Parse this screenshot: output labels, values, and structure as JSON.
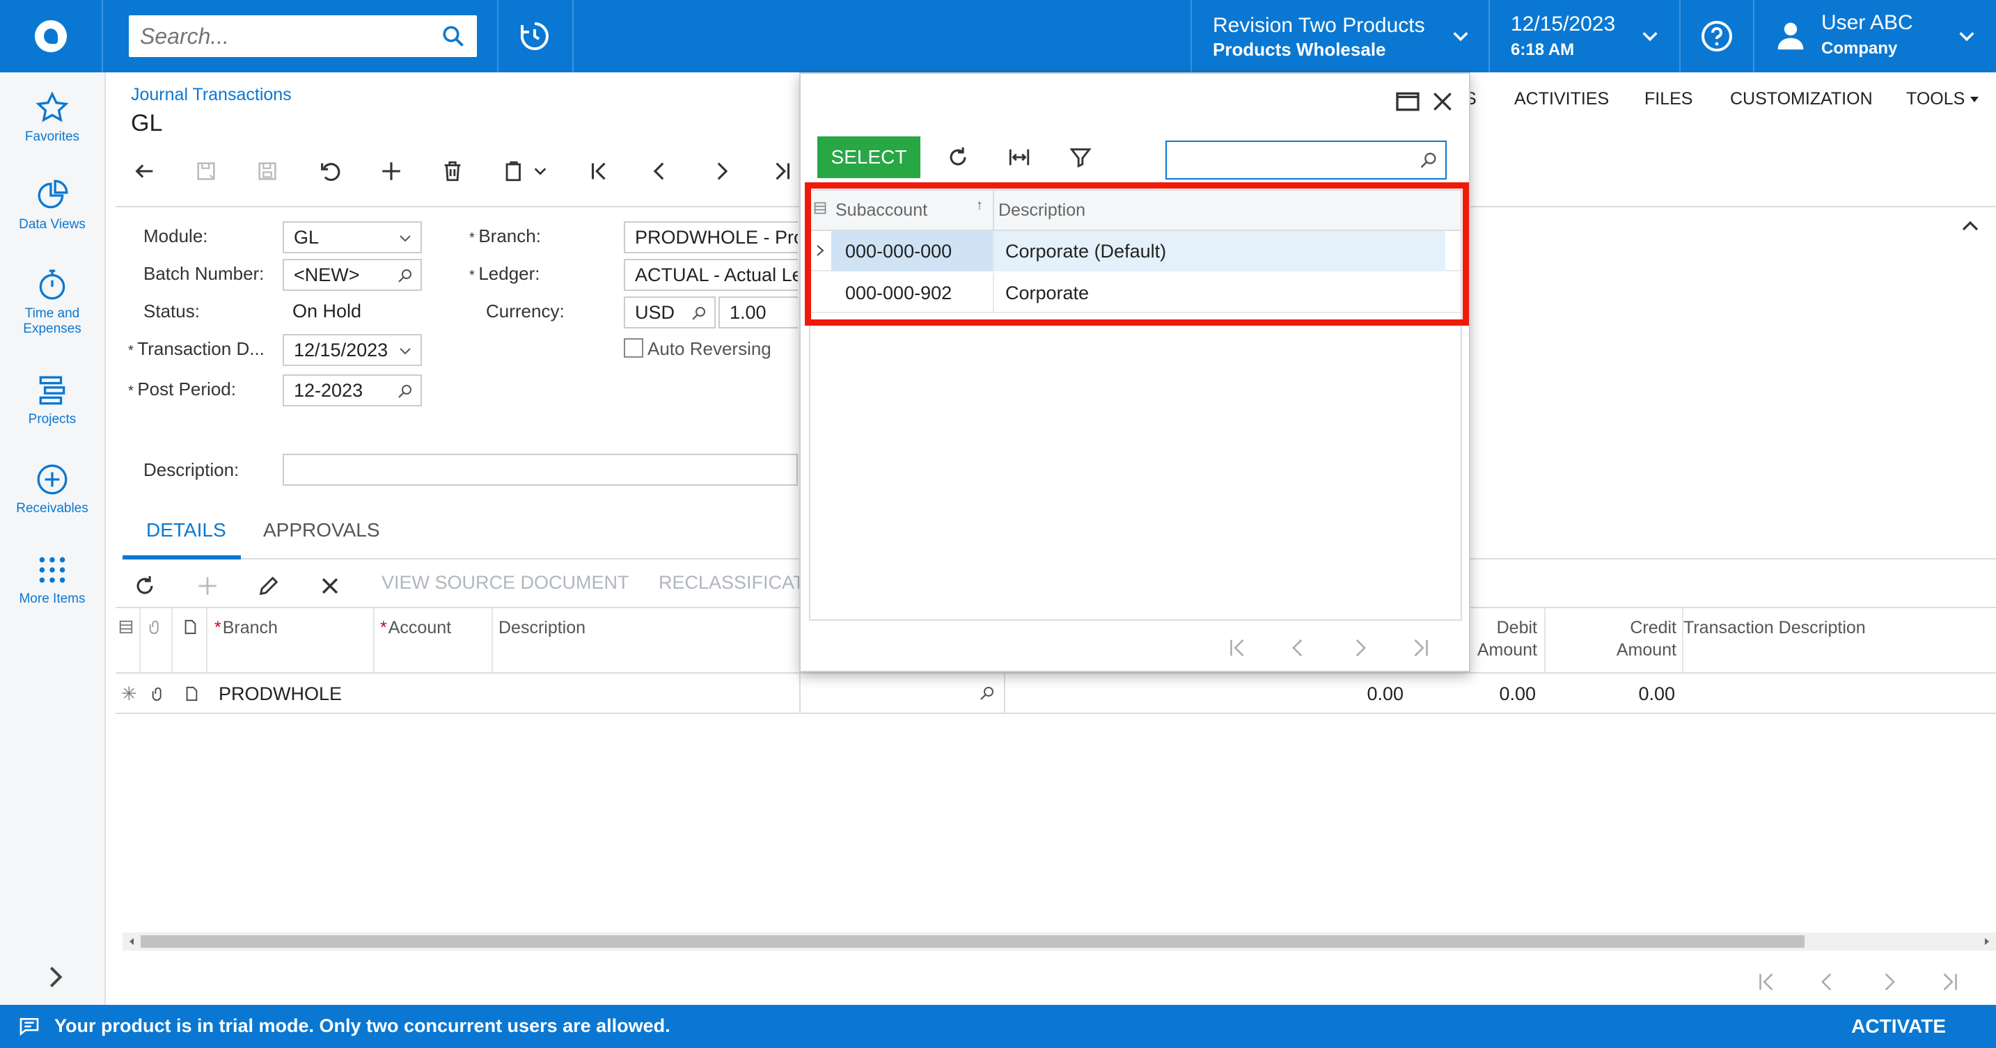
{
  "topbar": {
    "search_placeholder": "Search...",
    "tenant_name": "Revision Two Products",
    "tenant_branch": "Products Wholesale",
    "date": "12/15/2023",
    "time": "6:18 AM",
    "user_name": "User ABC",
    "user_company": "Company"
  },
  "leftnav": {
    "items": [
      {
        "label": "Favorites",
        "icon": "star-icon"
      },
      {
        "label": "Data Views",
        "icon": "pie-chart-icon"
      },
      {
        "label": "Time and Expenses",
        "icon": "stopwatch-icon"
      },
      {
        "label": "Projects",
        "icon": "projects-icon"
      },
      {
        "label": "Receivables",
        "icon": "plus-circle-icon"
      },
      {
        "label": "More Items",
        "icon": "grid-dots-icon"
      }
    ]
  },
  "header": {
    "breadcrumb": "Journal Transactions",
    "title": "GL",
    "right_menu": [
      "ACTIVITIES",
      "FILES",
      "CUSTOMIZATION",
      "TOOLS"
    ],
    "right_menu_partial": "S"
  },
  "form": {
    "module_label": "Module:",
    "module_value": "GL",
    "batch_label": "Batch Number:",
    "batch_value": "<NEW>",
    "status_label": "Status:",
    "status_value": "On Hold",
    "trans_date_label": "Transaction D...",
    "trans_date_value": "12/15/2023",
    "post_period_label": "Post Period:",
    "post_period_value": "12-2023",
    "description_label": "Description:",
    "branch_label": "Branch:",
    "branch_value": "PRODWHOLE - Pro",
    "ledger_label": "Ledger:",
    "ledger_value": "ACTUAL - Actual Le",
    "currency_label": "Currency:",
    "currency_value": "USD",
    "rate_value": "1.00",
    "auto_reversing_label": "Auto Reversing"
  },
  "tabs": {
    "details": "DETAILS",
    "approvals": "APPROVALS"
  },
  "grid_toolbar": {
    "view_source": "VIEW SOURCE DOCUMENT",
    "reclassify": "RECLASSIFICAT"
  },
  "grid": {
    "headers": {
      "branch": "Branch",
      "account": "Account",
      "description": "Description",
      "debit_line1": "Debit",
      "debit_line2": "Amount",
      "credit_line1": "Credit",
      "credit_line2": "Amount",
      "trans_desc": "Transaction Description"
    },
    "row": {
      "branch": "PRODWHOLE",
      "amount_a": "0.00",
      "debit": "0.00",
      "credit": "0.00"
    }
  },
  "lookup": {
    "select_label": "SELECT",
    "search_value": "",
    "col_subaccount": "Subaccount",
    "col_description": "Description",
    "rows": [
      {
        "subaccount": "000-000-000",
        "description": "Corporate (Default)"
      },
      {
        "subaccount": "000-000-902",
        "description": "Corporate"
      }
    ]
  },
  "statusbar": {
    "message": "Your product is in trial mode. Only two concurrent users are allowed.",
    "activate": "ACTIVATE"
  },
  "colors": {
    "brand_blue": "#0a78d2",
    "select_green": "#28a745",
    "highlight_red": "#f01a0a"
  }
}
